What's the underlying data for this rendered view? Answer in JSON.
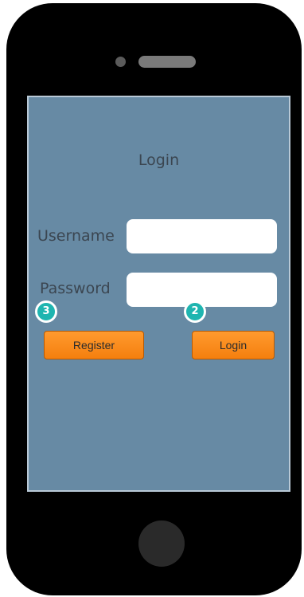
{
  "screen": {
    "title": "Login",
    "username_label": "Username",
    "password_label": "Password",
    "username_value": "",
    "password_value": "",
    "register_label": "Register",
    "login_label": "Login"
  },
  "annotations": {
    "badge_register": "3",
    "badge_login": "2"
  },
  "colors": {
    "screen_bg": "#678aa4",
    "button_accent": "#f57f0e",
    "badge": "#1fb5b0",
    "phone_body": "#000000"
  }
}
